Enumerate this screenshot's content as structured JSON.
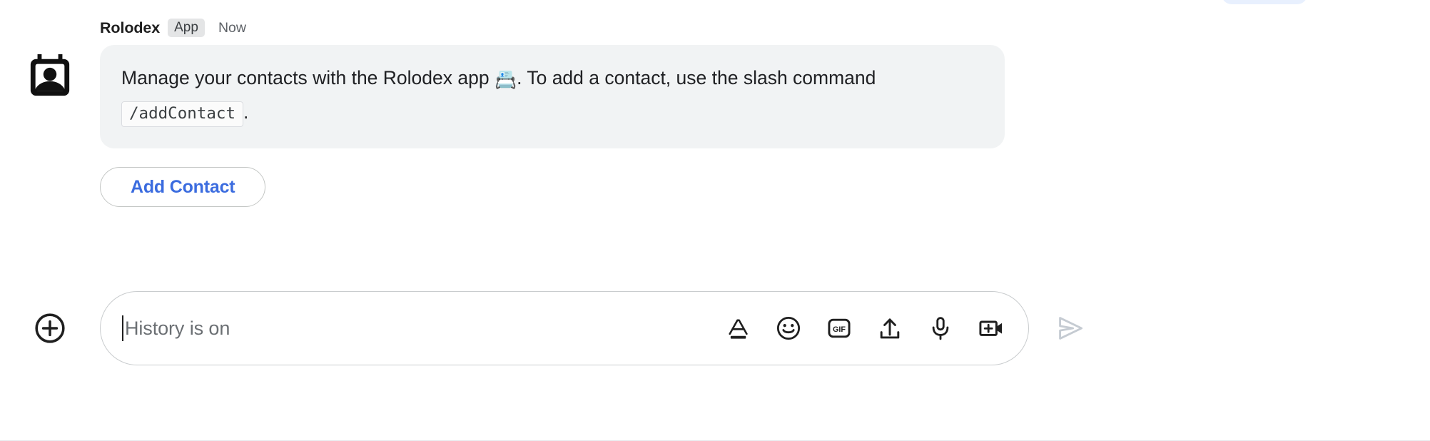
{
  "message": {
    "avatar_icon": "rolodex-contact-card-icon",
    "sender": "Rolodex",
    "badge": "App",
    "timestamp": "Now",
    "body": {
      "text_before_emoji": "Manage your contacts with the Rolodex app ",
      "emoji": "📇",
      "text_after_emoji": ". To add a contact, use the slash command ",
      "code": "/addContact",
      "text_end": "."
    },
    "action_button": "Add Contact"
  },
  "composer": {
    "add_button_icon": "plus-circle-icon",
    "placeholder": "History is on",
    "value": "",
    "tools": [
      {
        "icon": "format-text-icon",
        "label": "Format text"
      },
      {
        "icon": "emoji-icon",
        "label": "Insert emoji"
      },
      {
        "icon": "gif-icon",
        "label": "Insert GIF"
      },
      {
        "icon": "upload-icon",
        "label": "Upload file"
      },
      {
        "icon": "microphone-icon",
        "label": "Record voice message"
      },
      {
        "icon": "add-video-icon",
        "label": "Add video meeting"
      }
    ],
    "send_icon": "send-arrow-icon"
  },
  "colors": {
    "accent_blue": "#3b6cdf",
    "bubble_bg": "#f1f3f4",
    "badge_bg": "#e4e5e6",
    "border_gray": "#c9ccce",
    "send_disabled": "#c5cbd2",
    "text_primary": "#202124",
    "text_secondary": "#5f6368"
  }
}
